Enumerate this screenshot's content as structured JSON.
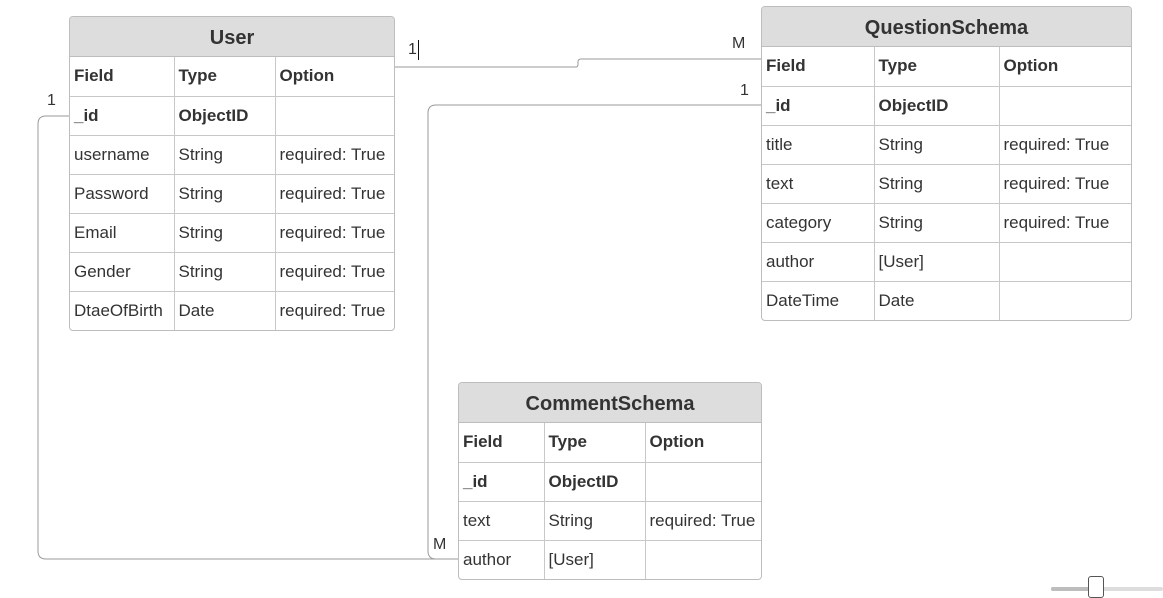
{
  "entities": {
    "user": {
      "title": "User",
      "header": [
        "Field",
        "Type",
        "Option"
      ],
      "rows": [
        [
          "_id",
          "ObjectID",
          ""
        ],
        [
          "username",
          "String",
          "required: True"
        ],
        [
          "Password",
          "String",
          "required: True"
        ],
        [
          "Email",
          "String",
          "required: True"
        ],
        [
          "Gender",
          "String",
          "required: True"
        ],
        [
          "DtaeOfBirth",
          "Date",
          "required: True"
        ]
      ]
    },
    "question": {
      "title": "QuestionSchema",
      "header": [
        "Field",
        "Type",
        "Option"
      ],
      "rows": [
        [
          "_id",
          "ObjectID",
          ""
        ],
        [
          "title",
          "String",
          "required: True"
        ],
        [
          "text",
          "String",
          "required: True"
        ],
        [
          "category",
          "String",
          "required: True"
        ],
        [
          "author",
          "[User]",
          ""
        ],
        [
          "DateTime",
          "Date",
          ""
        ]
      ]
    },
    "comment": {
      "title": "CommentSchema",
      "header": [
        "Field",
        "Type",
        "Option"
      ],
      "rows": [
        [
          "_id",
          "ObjectID",
          ""
        ],
        [
          "text",
          "String",
          "required: True"
        ],
        [
          "author",
          "[User]",
          ""
        ]
      ]
    }
  },
  "relations": {
    "user_question": {
      "from_label": "1",
      "to_label": "M"
    },
    "question_comment": {
      "from_label": "1",
      "to_label": "M"
    },
    "user_comment": {
      "from_label": "1",
      "to_label": "M"
    }
  },
  "zoom": {
    "level": 0.4
  },
  "colors": {
    "header_bg": "#dddddd",
    "border": "#bdbdbd",
    "connector": "#9a9a9a"
  }
}
